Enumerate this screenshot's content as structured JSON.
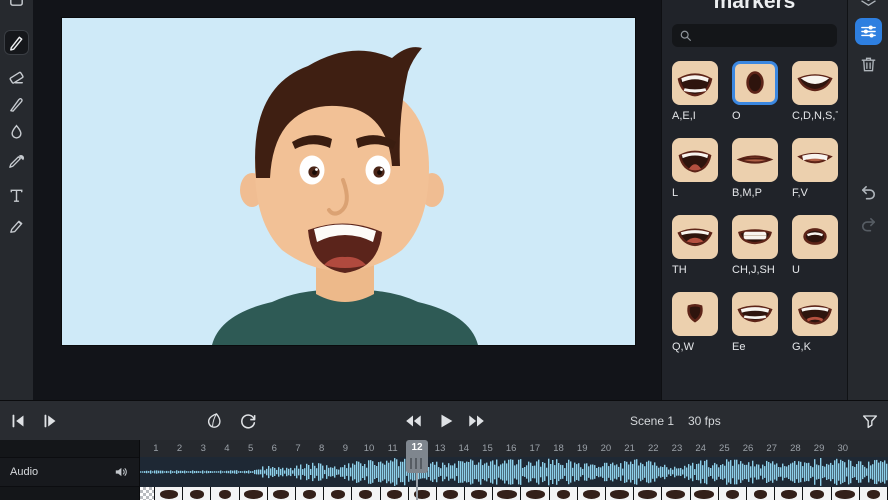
{
  "colors": {
    "accent": "#3b87e0",
    "waveform": "#8ed0ea",
    "mouth_thumb_bg": "#ecd0ae",
    "canvas_bg": "#cfeaf8"
  },
  "left_toolbar": {
    "tools": [
      {
        "name": "pen",
        "selected": true
      },
      {
        "name": "eraser",
        "selected": false
      },
      {
        "name": "knife",
        "selected": false
      },
      {
        "name": "fill",
        "selected": false
      },
      {
        "name": "eyedropper",
        "selected": false
      },
      {
        "name": "text",
        "selected": false
      },
      {
        "name": "marker",
        "selected": false
      }
    ]
  },
  "right_panel": {
    "title": "markers",
    "mouths": [
      {
        "label": "A,E,I",
        "selected": false
      },
      {
        "label": "O",
        "selected": true
      },
      {
        "label": "C,D,N,S,T...",
        "selected": false
      },
      {
        "label": "L",
        "selected": false
      },
      {
        "label": "B,M,P",
        "selected": false
      },
      {
        "label": "F,V",
        "selected": false
      },
      {
        "label": "TH",
        "selected": false
      },
      {
        "label": "CH,J,SH",
        "selected": false
      },
      {
        "label": "U",
        "selected": false
      },
      {
        "label": "Q,W",
        "selected": false
      },
      {
        "label": "Ee",
        "selected": false
      },
      {
        "label": "G,K",
        "selected": false
      }
    ]
  },
  "transport": {
    "scene": "Scene 1",
    "fps": "30 fps"
  },
  "timeline": {
    "frames": [
      1,
      2,
      3,
      4,
      5,
      6,
      7,
      8,
      9,
      10,
      11,
      12,
      13,
      14,
      15,
      16,
      17,
      18,
      19,
      20,
      21,
      22,
      23,
      24,
      25,
      26,
      27,
      28,
      29,
      30
    ],
    "current_frame": 12
  },
  "tracks": {
    "audio": "Audio"
  }
}
